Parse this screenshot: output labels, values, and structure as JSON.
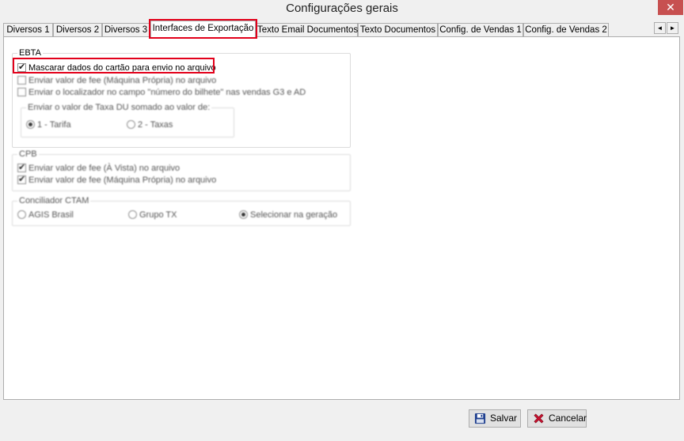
{
  "window": {
    "title": "Configurações gerais",
    "close": "✕"
  },
  "tabs": [
    "Diversos 1",
    "Diversos 2",
    "Diversos 3",
    "Interfaces de Exportação",
    "Texto Email Documentos",
    "Texto Documentos",
    "Config. de Vendas 1",
    "Config. de Vendas 2"
  ],
  "active_tab": "Interfaces de Exportação",
  "tab_scroll": {
    "left": "◄",
    "right": "►"
  },
  "ebta": {
    "legend": "EBTA",
    "mask_card": {
      "label": "Mascarar dados do cartão para envio no arquivo",
      "checked": true
    },
    "send_fee": {
      "label": "Enviar valor de fee (Máquina Própria) no arquivo",
      "checked": false
    },
    "send_locator": {
      "label": "Enviar o localizador no campo \"número do bilhete\" nas vendas G3 e AD",
      "checked": false
    },
    "du_group": {
      "legend": "Enviar o valor de Taxa DU somado ao valor de:",
      "options": [
        {
          "label": "1 - Tarifa",
          "selected": true
        },
        {
          "label": "2 - Taxas",
          "selected": false
        }
      ]
    }
  },
  "cpb": {
    "legend": "CPB",
    "send_fee_cash": {
      "label": "Enviar valor de fee (À Vista) no arquivo",
      "checked": true
    },
    "send_fee_machine": {
      "label": "Enviar valor de fee (Máquina Própria) no arquivo",
      "checked": true
    }
  },
  "ctam": {
    "legend": "Conciliador CTAM",
    "options": [
      {
        "label": "AGIS Brasil",
        "selected": false
      },
      {
        "label": "Grupo TX",
        "selected": false
      },
      {
        "label": "Selecionar na geração",
        "selected": true
      }
    ]
  },
  "footer": {
    "save": "Salvar",
    "cancel": "Cancelar"
  },
  "colors": {
    "highlight": "#e2001a",
    "save_icon": "#1f3f8f",
    "cancel_icon": "#c8102e"
  }
}
